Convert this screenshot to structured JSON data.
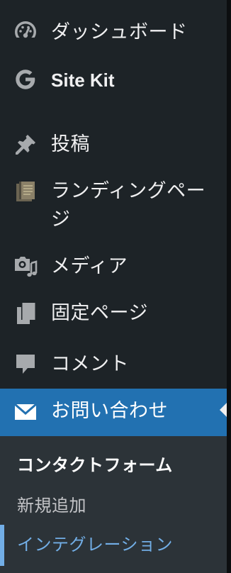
{
  "menu": {
    "dashboard": {
      "label": "ダッシュボード",
      "icon": "dashboard-gauge-icon"
    },
    "sitekit": {
      "label": "Site Kit",
      "icon": "google-g-icon"
    },
    "posts": {
      "label": "投稿",
      "icon": "pushpin-icon"
    },
    "landing": {
      "label": "ランディングページ",
      "icon": "landing-page-book-icon"
    },
    "media": {
      "label": "メディア",
      "icon": "media-camera-music-icon"
    },
    "pages": {
      "label": "固定ページ",
      "icon": "pages-icon"
    },
    "comments": {
      "label": "コメント",
      "icon": "comment-bubble-icon"
    },
    "contact": {
      "label": "お問い合わせ",
      "icon": "envelope-icon"
    }
  },
  "submenu": {
    "header": "コンタクトフォーム",
    "items": [
      "新規追加",
      "インテグレーション"
    ]
  },
  "colors": {
    "sidebar_bg": "#1d2327",
    "submenu_bg": "#2c3338",
    "active_bg": "#2271b1",
    "icon_color": "#a7aaad",
    "text": "#f0f0f1",
    "sub_link_active": "#72aee6"
  }
}
